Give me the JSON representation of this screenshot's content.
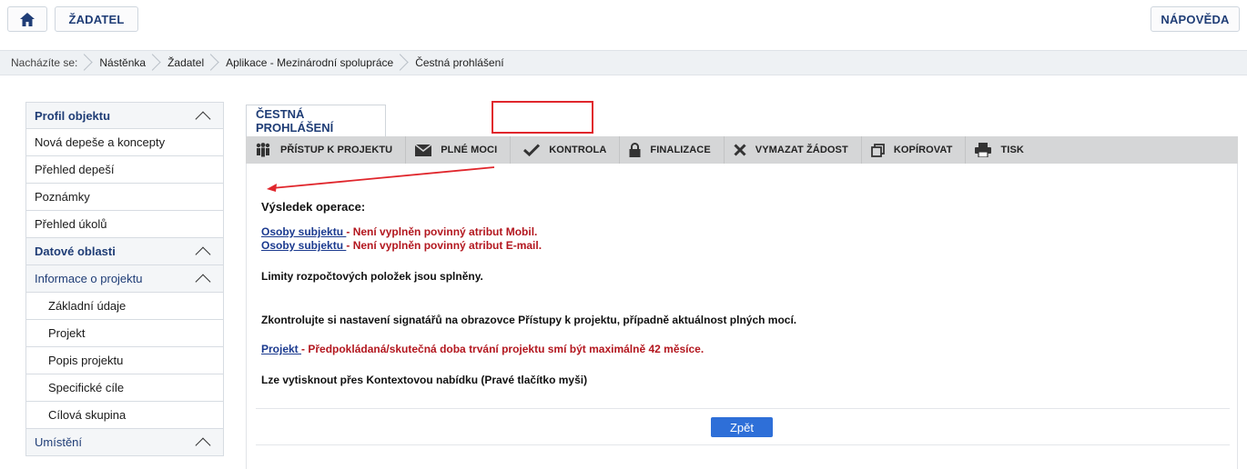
{
  "topbar": {
    "home_icon": "home-icon",
    "zadatel_label": "ŽADATEL",
    "napoveda_label": "NÁPOVĚDA"
  },
  "breadcrumb": {
    "prefix": "Nacházíte se:",
    "items": [
      "Nástěnka",
      "Žadatel",
      "Aplikace - Mezinárodní spolupráce",
      "Čestná prohlášení"
    ]
  },
  "sidebar": {
    "items": [
      {
        "label": "Profil objektu"
      },
      {
        "label": "Nová depeše a koncepty"
      },
      {
        "label": "Přehled depeší"
      },
      {
        "label": "Poznámky"
      },
      {
        "label": "Přehled úkolů"
      },
      {
        "label": "Datové oblasti"
      },
      {
        "label": "Informace o projektu"
      },
      {
        "label": "Základní údaje"
      },
      {
        "label": "Projekt"
      },
      {
        "label": "Popis projektu"
      },
      {
        "label": "Specifické cíle"
      },
      {
        "label": "Cílová skupina"
      },
      {
        "label": "Umístění"
      }
    ]
  },
  "main": {
    "tab_label": "ČESTNÁ PROHLÁŠENÍ",
    "toolbar": [
      {
        "label": "PŘÍSTUP K PROJEKTU",
        "icon": "people-icon"
      },
      {
        "label": "PLNÉ MOCI",
        "icon": "envelope-icon"
      },
      {
        "label": "KONTROLA",
        "icon": "check-icon"
      },
      {
        "label": "FINALIZACE",
        "icon": "lock-icon"
      },
      {
        "label": "VYMAZAT ŽÁDOST",
        "icon": "x-icon"
      },
      {
        "label": "KOPÍROVAT",
        "icon": "copy-icon"
      },
      {
        "label": "TISK",
        "icon": "printer-icon"
      }
    ],
    "result_heading": "Výsledek operace:",
    "msg1_link": "Osoby subjektu ",
    "msg1_text": "- Není vyplněn povinný atribut Mobil.",
    "msg2_link": "Osoby subjektu ",
    "msg2_text": "- Není vyplněn povinný atribut E-mail.",
    "limits": "Limity rozpočtových položek jsou splněny.",
    "check_signatories": "Zkontrolujte si nastavení signatářů na obrazovce Přístupy k projektu, případně aktuálnost plných mocí.",
    "msg3_link": "Projekt ",
    "msg3_text": "- Předpokládaná/skutečná doba trvání projektu smí být maximálně 42 měsíce.",
    "print_hint": "Lze vytisknout přes Kontextovou nabídku (Pravé tlačítko myši)",
    "back_label": "Zpět"
  },
  "colors": {
    "accent": "#1f3d76",
    "error": "#b3171f",
    "highlight": "#e0262c",
    "button": "#2e6fd8"
  }
}
